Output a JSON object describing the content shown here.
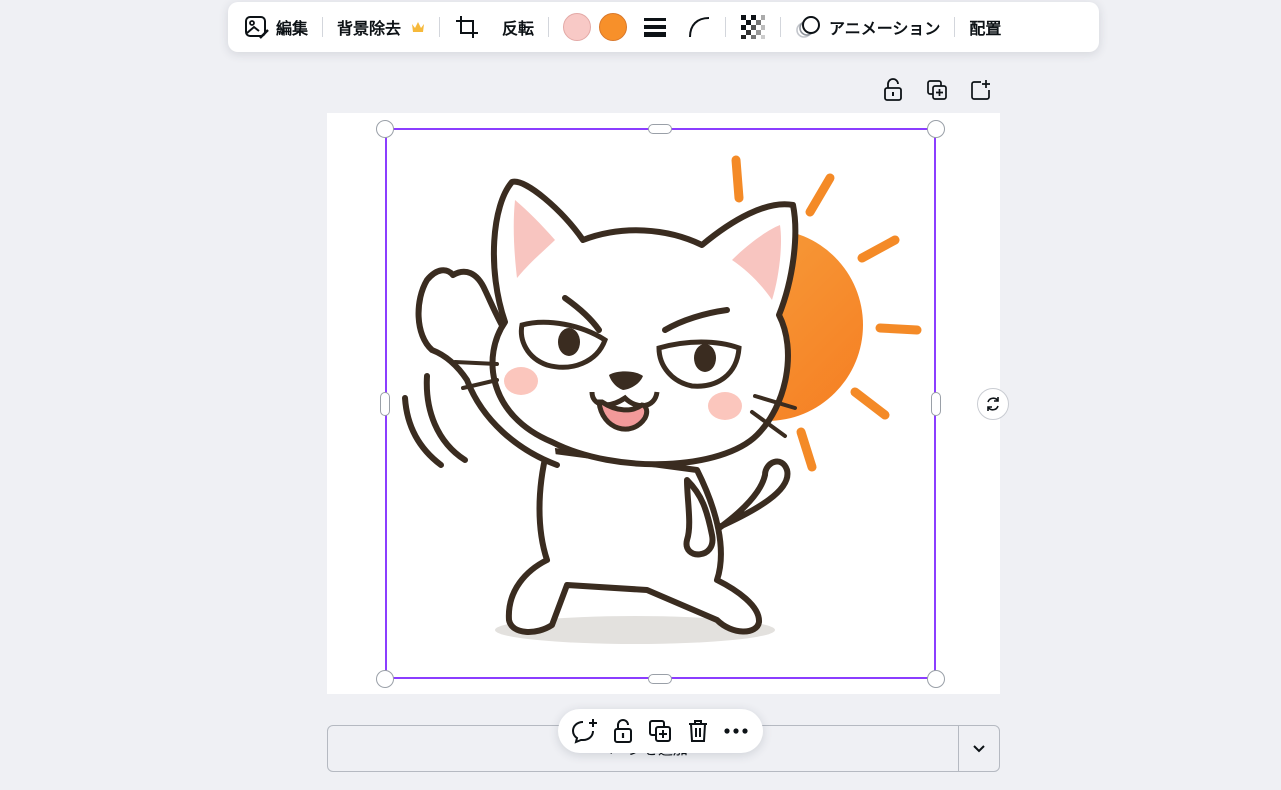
{
  "toolbar": {
    "edit_label": "編集",
    "bg_remove_label": "背景除去",
    "flip_label": "反転",
    "animate_label": "アニメーション",
    "arrange_label": "配置",
    "icons": [
      "image-edit-icon",
      "crown-icon",
      "crop-icon",
      "stroke-weight-icon",
      "corner-rounding-icon",
      "transparency-icon",
      "animation-icon"
    ],
    "colors": {
      "swatch_1": "#f8c9c6",
      "swatch_2": "#f7902a",
      "crown": "#f6b93b"
    }
  },
  "page_tools": {
    "icons": [
      "lock-icon",
      "duplicate-page-icon",
      "add-page-icon"
    ]
  },
  "selection": {
    "accent": "#8b3dff"
  },
  "bottom": {
    "add_page_label": "ページを追加",
    "float_icons": [
      "comment-icon",
      "lock-icon",
      "duplicate-icon",
      "trash-icon",
      "more-icon"
    ]
  }
}
